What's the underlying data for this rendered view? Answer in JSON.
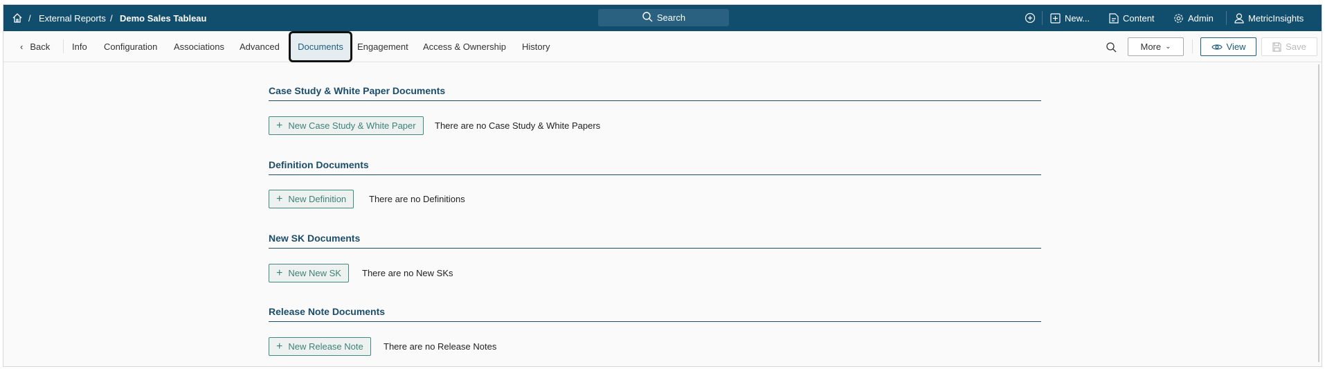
{
  "topbar": {
    "breadcrumb": [
      "External Reports",
      "Demo Sales Tableau"
    ],
    "search_label": "Search",
    "new_label": "New...",
    "content_label": "Content",
    "admin_label": "Admin",
    "user_label": "MetricInsights"
  },
  "nav": {
    "back": "Back",
    "tabs": [
      "Info",
      "Configuration",
      "Associations",
      "Advanced",
      "Documents",
      "Engagement",
      "Access & Ownership",
      "History"
    ],
    "active_tab": "Documents",
    "more": "More",
    "view": "View",
    "save": "Save"
  },
  "sections": [
    {
      "title": "Case Study & White Paper Documents",
      "button": "New Case Study & White Paper",
      "empty": "There are no Case Study & White Papers"
    },
    {
      "title": "Definition Documents",
      "button": "New Definition",
      "empty": "There are no Definitions"
    },
    {
      "title": "New SK Documents",
      "button": "New New SK",
      "empty": "There are no New SKs"
    },
    {
      "title": "Release Note Documents",
      "button": "New Release Note",
      "empty": "There are no Release Notes"
    }
  ]
}
